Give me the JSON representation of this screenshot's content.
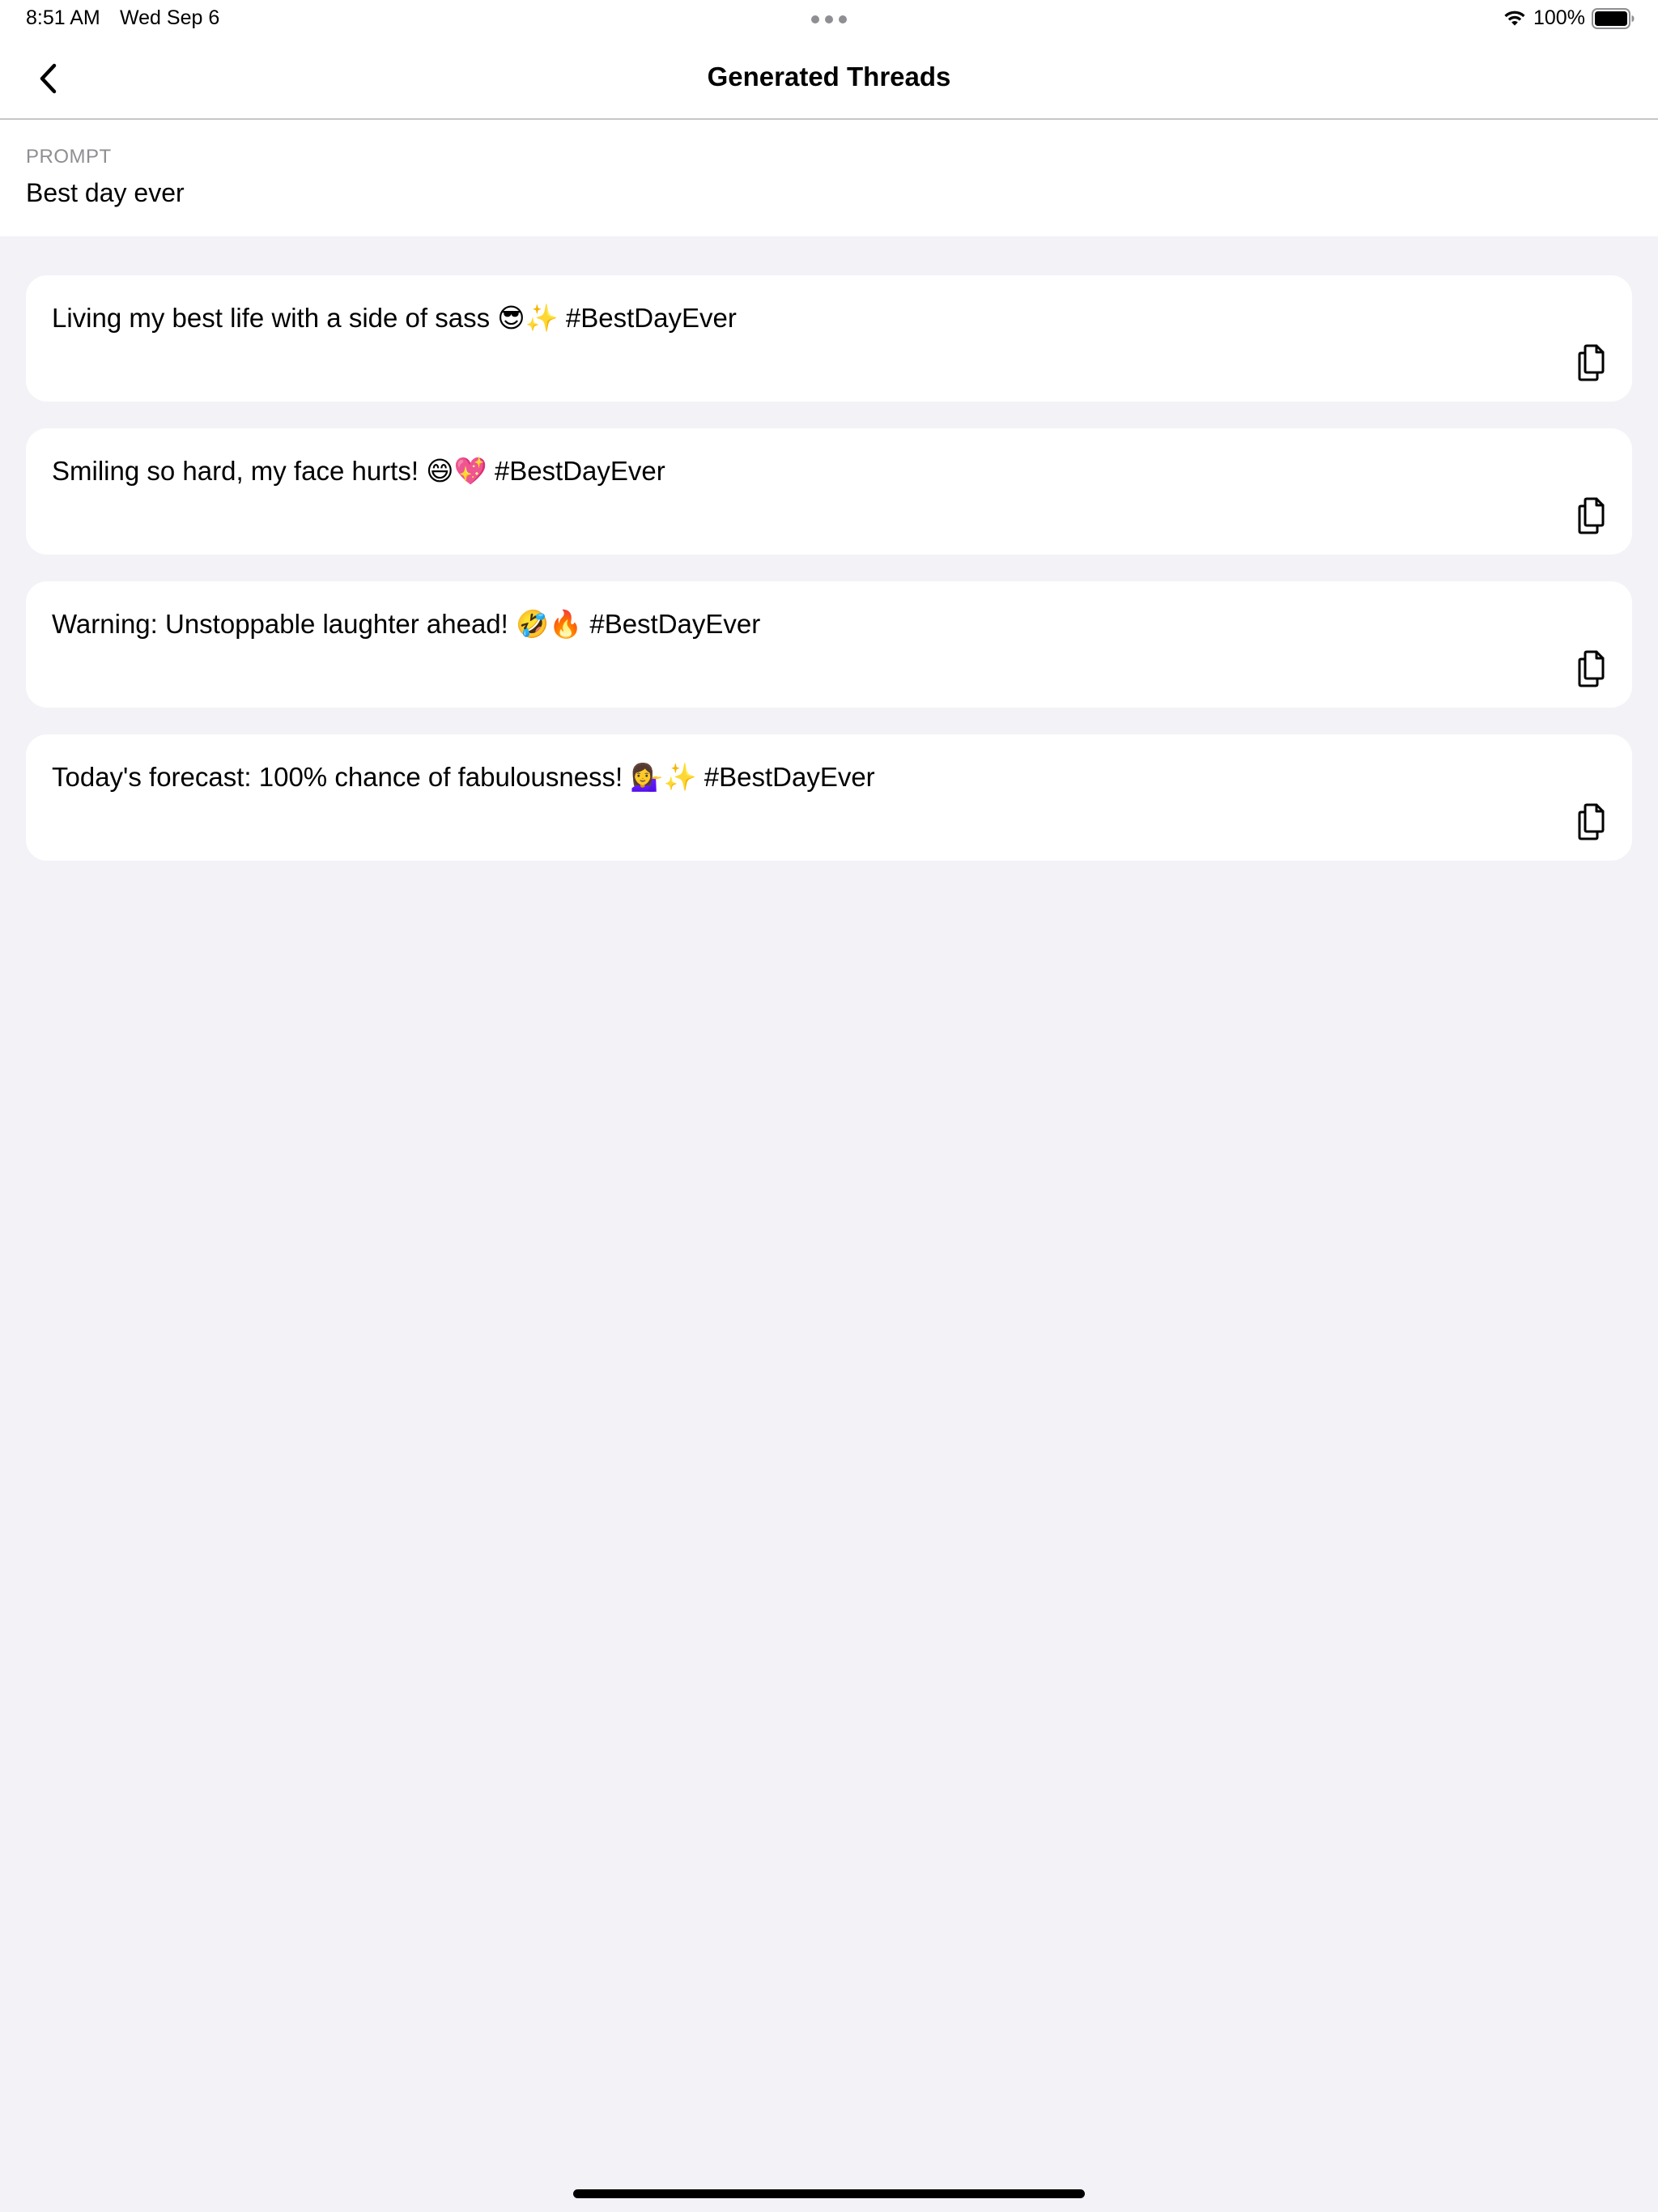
{
  "status_bar": {
    "time": "8:51 AM",
    "date": "Wed Sep 6",
    "battery_percent": "100%"
  },
  "nav": {
    "title": "Generated Threads",
    "back_icon": "chevron-left-icon"
  },
  "prompt": {
    "label": "PROMPT",
    "value": "Best day ever"
  },
  "threads": [
    {
      "text": "Living my best life with a side of sass 😎✨ #BestDayEver"
    },
    {
      "text": "Smiling so hard, my face hurts! 😄💖 #BestDayEver"
    },
    {
      "text": "Warning: Unstoppable laughter ahead! 🤣🔥 #BestDayEver"
    },
    {
      "text": "Today's forecast: 100% chance of fabulousness! 💁‍♀️✨ #BestDayEver"
    }
  ],
  "icons": {
    "copy": "copy-icon"
  },
  "colors": {
    "background": "#f2f2f7",
    "card": "#ffffff",
    "secondary_text": "#8e8e93"
  }
}
